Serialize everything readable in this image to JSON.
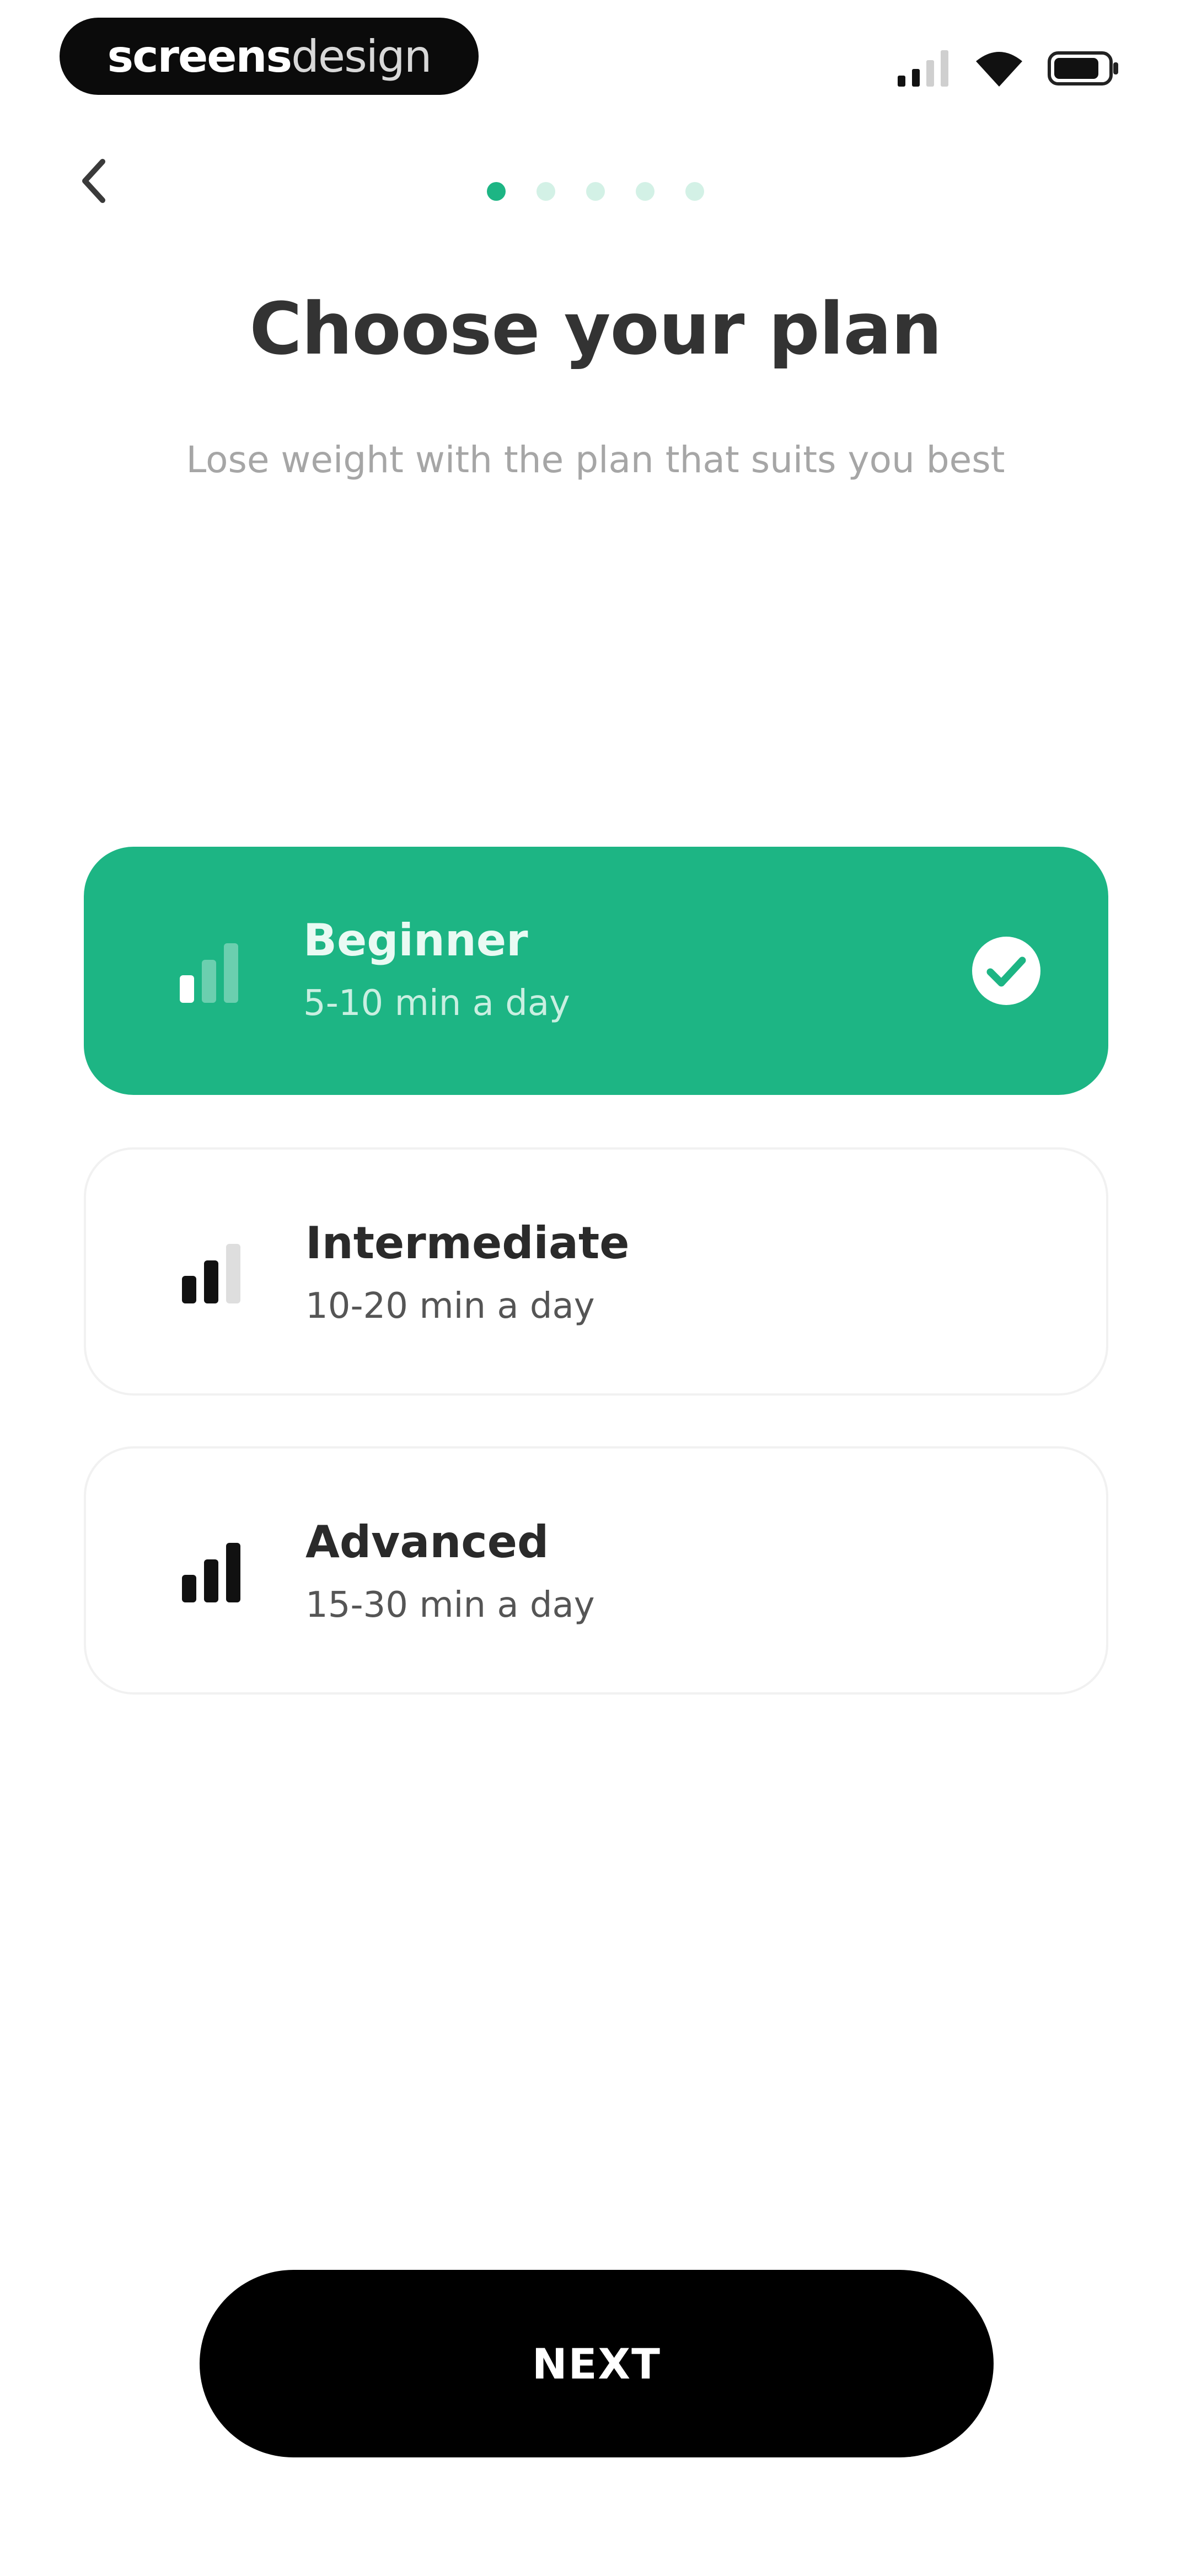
{
  "status_bar": {
    "brand_bold": "screens",
    "brand_light": "design",
    "icons": [
      "signal-icon",
      "wifi-icon",
      "battery-icon"
    ]
  },
  "header": {
    "back_icon": "chevron-left-icon",
    "pager": {
      "total": 5,
      "active_index": 0
    }
  },
  "title": "Choose your plan",
  "subtitle": "Lose weight with the plan that suits you best",
  "plans": [
    {
      "name": "Beginner",
      "duration": "5-10 min a day",
      "level": 1,
      "selected": true
    },
    {
      "name": "Intermediate",
      "duration": "10-20 min a day",
      "level": 2,
      "selected": false
    },
    {
      "name": "Advanced",
      "duration": "15-30 min a day",
      "level": 3,
      "selected": false
    }
  ],
  "next_button": {
    "label": "NEXT"
  },
  "colors": {
    "accent": "#1db584",
    "accent_light": "#d3f1e6",
    "button": "#000000",
    "title": "#333333",
    "subtitle": "#a6a6a6"
  }
}
